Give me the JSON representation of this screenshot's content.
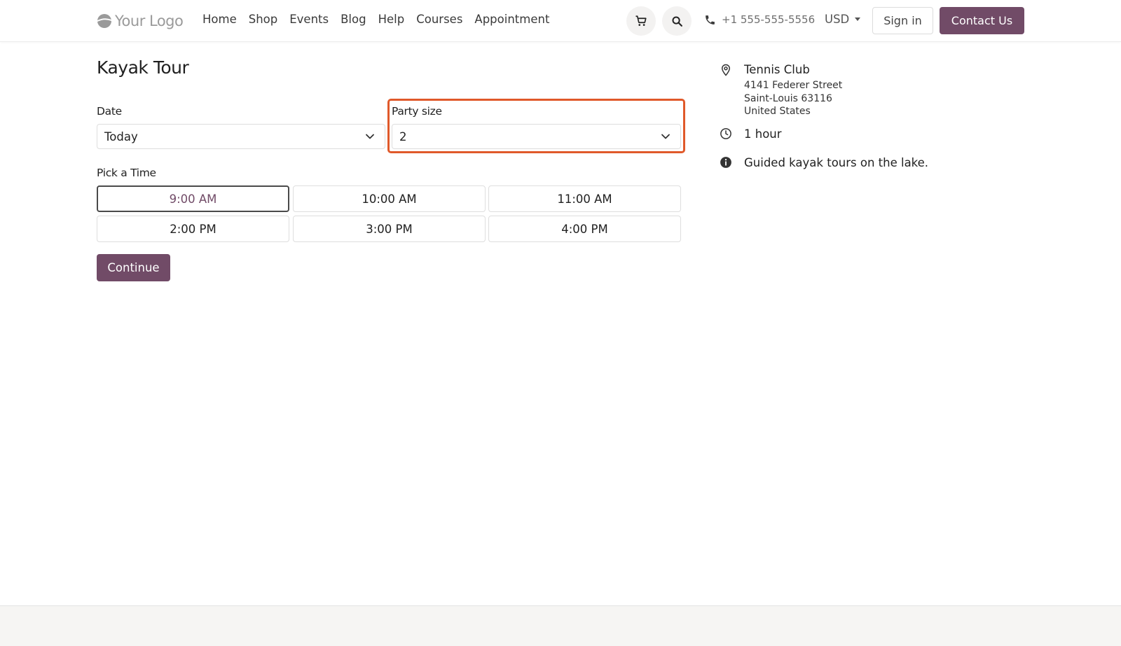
{
  "header": {
    "logo_text": "Your Logo",
    "nav": [
      "Home",
      "Shop",
      "Events",
      "Blog",
      "Help",
      "Courses",
      "Appointment"
    ],
    "phone": "+1 555-555-5556",
    "currency": "USD",
    "sign_in": "Sign in",
    "contact": "Contact Us"
  },
  "booking": {
    "title": "Kayak Tour",
    "date_label": "Date",
    "date_value": "Today",
    "party_label": "Party size",
    "party_value": "2",
    "time_label": "Pick a Time",
    "slots": [
      "9:00 AM",
      "10:00 AM",
      "11:00 AM",
      "2:00 PM",
      "3:00 PM",
      "4:00 PM"
    ],
    "selected_slot": "9:00 AM",
    "continue": "Continue"
  },
  "info": {
    "location_name": "Tennis Club",
    "address_lines": [
      "4141 Federer Street",
      "Saint-Louis 63116",
      "United States"
    ],
    "duration": "1 hour",
    "description": "Guided kayak tours on the lake."
  },
  "colors": {
    "brand": "#714b67",
    "highlight": "#e0592a"
  }
}
